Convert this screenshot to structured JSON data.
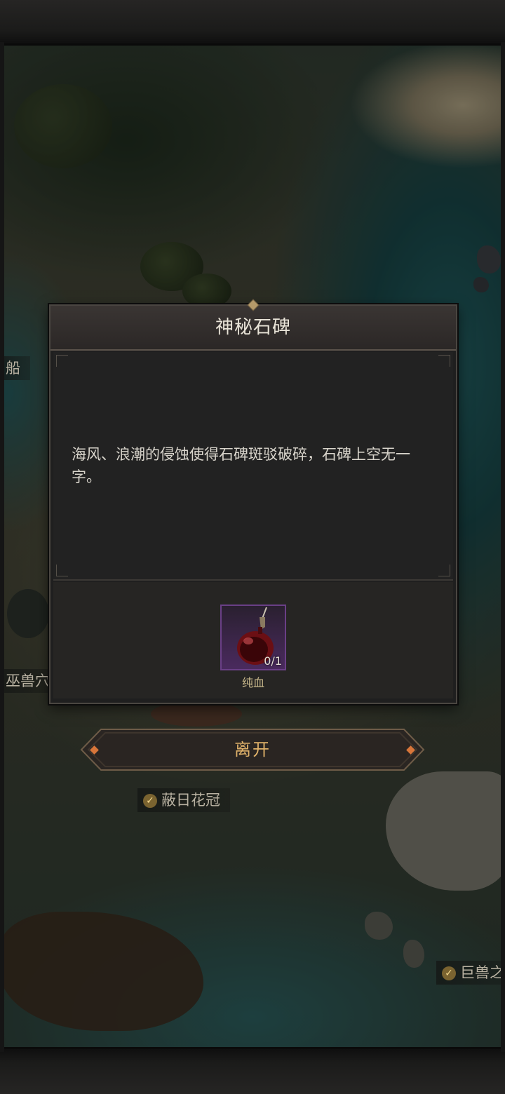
{
  "dialog": {
    "title": "神秘石碑",
    "description": "海风、浪潮的侵蚀使得石碑斑驳破碎，石碑上空无一字。",
    "reward": {
      "name": "纯血",
      "count": "0/1",
      "icon": "blood-potion-icon"
    }
  },
  "actions": {
    "leave_label": "离开"
  },
  "map_labels": {
    "ship": "船",
    "beast_den": "巫兽穴",
    "sun_crown": "蔽日花冠",
    "beast_area": "巨兽之"
  },
  "colors": {
    "accent_gold": "#e0b26a",
    "item_rarity_purple": "#6a3f86",
    "check_badge": "#7a6330"
  }
}
